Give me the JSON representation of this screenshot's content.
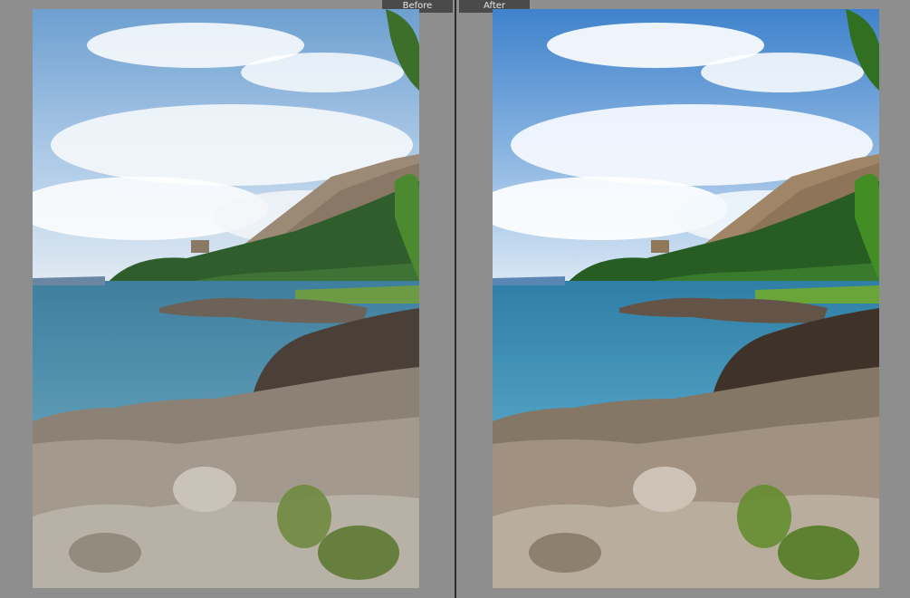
{
  "compare": {
    "before_label": "Before",
    "after_label": "After"
  },
  "photos": {
    "before": {
      "scene": "coastal-landscape",
      "variant": "before"
    },
    "after": {
      "scene": "coastal-landscape",
      "variant": "after"
    }
  },
  "colors": {
    "background": "#8e8e8e",
    "divider": "#2b2b2b",
    "tab": "#4a4a4a",
    "tab_text": "#e8e8e8"
  }
}
